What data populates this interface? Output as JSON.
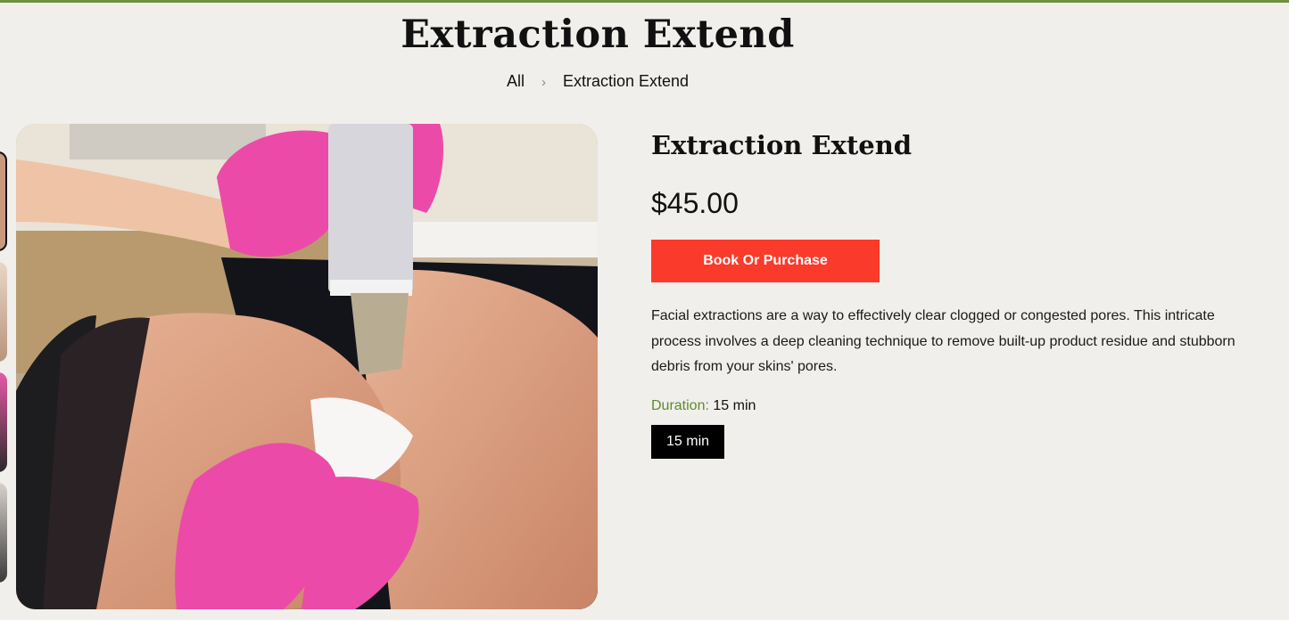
{
  "header": {
    "title": "Extraction Extend",
    "accent_color": "#6f8f3d"
  },
  "breadcrumb": {
    "items": [
      {
        "label": "All"
      },
      {
        "label": "Extraction Extend"
      }
    ],
    "separator": "›"
  },
  "gallery": {
    "main_image_icon": "facial-extraction-photo",
    "thumbnail_count": 4
  },
  "product": {
    "title": "Extraction Extend",
    "price": "$45.00",
    "cta_label": "Book Or Purchase",
    "cta_color": "#fa3a2a",
    "description": "Facial extractions are a way to effectively clear clogged or congested pores. This intricate process involves a deep cleaning technique to remove built-up product residue and stubborn debris from your skins' pores.",
    "duration_label": "Duration:",
    "duration_value": "15 min",
    "duration_options": [
      "15 min"
    ],
    "label_color": "#5f8a2e"
  }
}
